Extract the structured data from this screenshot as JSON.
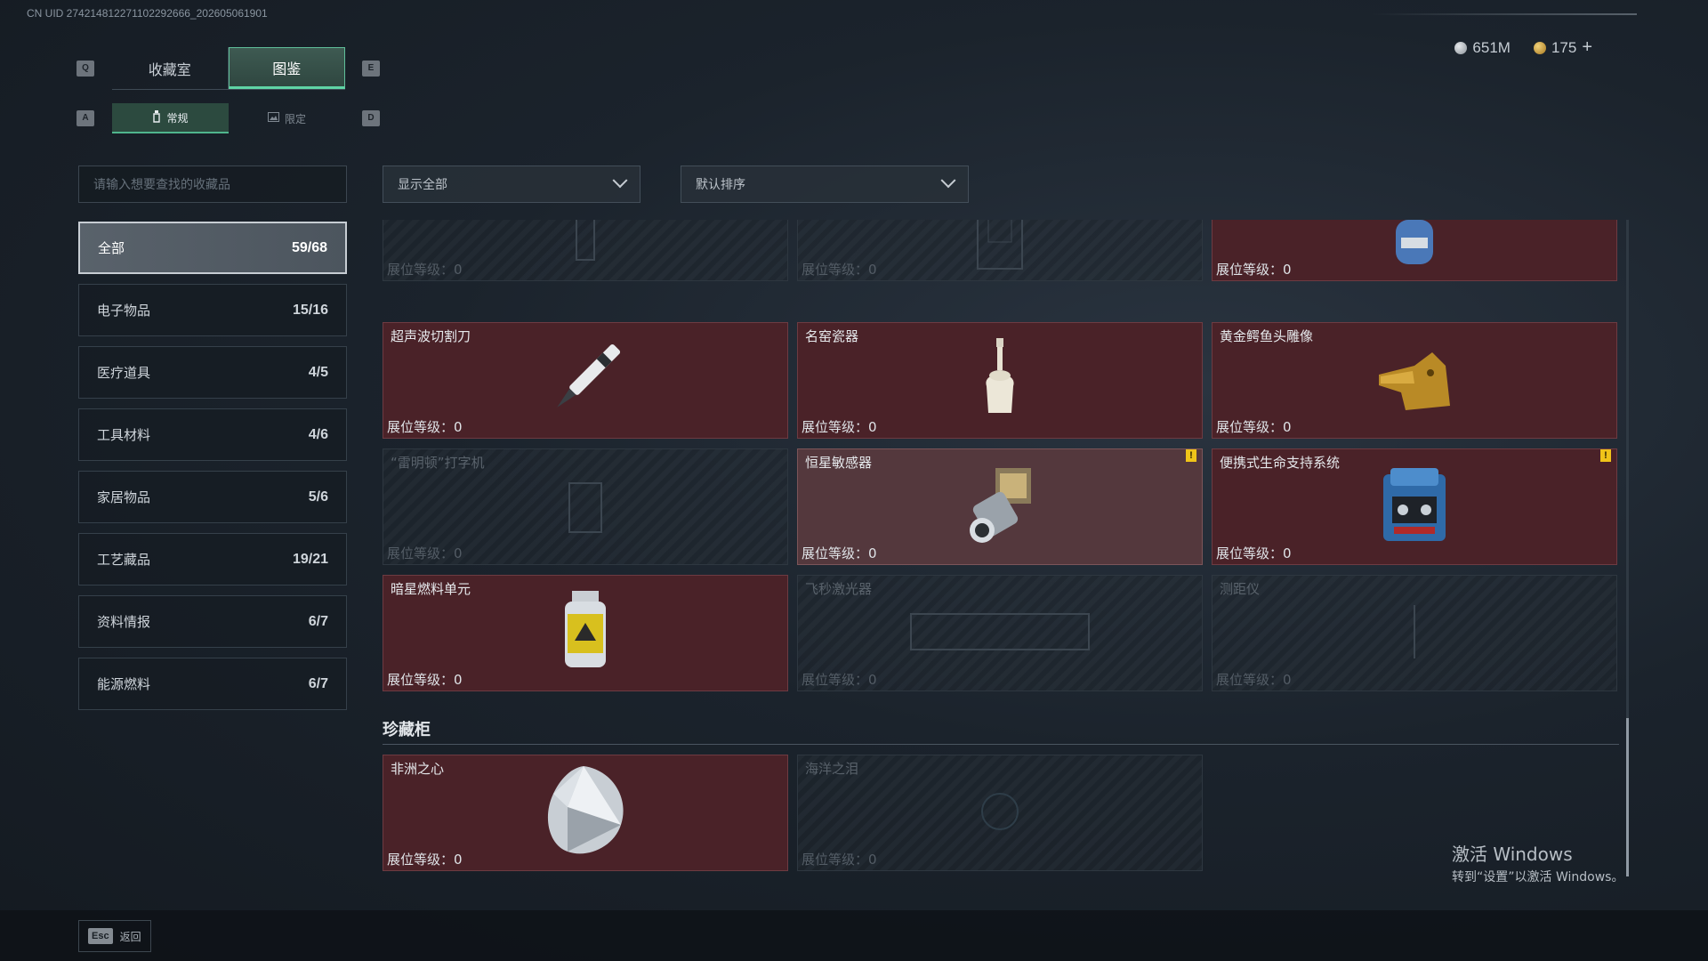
{
  "uid_text": "CN UID 274214812271102292666_202605061901",
  "hotkeys": {
    "prev_tab": "Q",
    "next_tab": "E",
    "prev_sub": "A",
    "next_sub": "D"
  },
  "tabs": [
    {
      "label": "收藏室",
      "active": false
    },
    {
      "label": "图鉴",
      "active": true
    }
  ],
  "subtabs": [
    {
      "label": "常规",
      "active": true,
      "icon": "bottle-icon"
    },
    {
      "label": "限定",
      "active": false,
      "icon": "image-icon"
    }
  ],
  "currency": {
    "silver": "651M",
    "gold": "175",
    "add": "+"
  },
  "search": {
    "placeholder": "请输入想要查找的收藏品"
  },
  "categories": [
    {
      "label": "全部",
      "count": "59/68",
      "active": true
    },
    {
      "label": "电子物品",
      "count": "15/16"
    },
    {
      "label": "医疗道具",
      "count": "4/5"
    },
    {
      "label": "工具材料",
      "count": "4/6"
    },
    {
      "label": "家居物品",
      "count": "5/6"
    },
    {
      "label": "工艺藏品",
      "count": "19/21"
    },
    {
      "label": "资料情报",
      "count": "6/7"
    },
    {
      "label": "能源燃料",
      "count": "6/7"
    }
  ],
  "filters": {
    "show": "显示全部",
    "sort": "默认排序"
  },
  "items": [
    {
      "name": "",
      "level": "展位等级：0",
      "owned": false,
      "icon": "figurine-icon"
    },
    {
      "name": "",
      "level": "展位等级：0",
      "owned": false,
      "icon": "cabinet-icon"
    },
    {
      "name": "",
      "level": "展位等级：0",
      "owned": true,
      "icon": "gas-canister-icon"
    },
    {
      "name": "超声波切割刀",
      "level": "展位等级：0",
      "owned": true,
      "icon": "ultrasonic-cutter-icon"
    },
    {
      "name": "名窑瓷器",
      "level": "展位等级：0",
      "owned": true,
      "icon": "porcelain-vase-icon"
    },
    {
      "name": "黄金鳄鱼头雕像",
      "level": "展位等级：0",
      "owned": true,
      "icon": "gold-crocodile-icon"
    },
    {
      "name": "“雷明顿”打字机",
      "level": "展位等级：0",
      "owned": false,
      "icon": "typewriter-icon"
    },
    {
      "name": "恒星敏感器",
      "level": "展位等级：0",
      "owned": true,
      "highlight": true,
      "warn": true,
      "icon": "star-sensor-icon"
    },
    {
      "name": "便携式生命支持系统",
      "level": "展位等级：0",
      "owned": true,
      "warn": true,
      "icon": "life-support-icon"
    },
    {
      "name": "暗星燃料单元",
      "level": "展位等级：0",
      "owned": true,
      "icon": "fuel-cell-icon"
    },
    {
      "name": "飞秒激光器",
      "level": "展位等级：0",
      "owned": false,
      "icon": "laser-icon"
    },
    {
      "name": "测距仪",
      "level": "展位等级：0",
      "owned": false,
      "icon": "rangefinder-icon"
    }
  ],
  "treasure_section": {
    "title": "珍藏柜",
    "items": [
      {
        "name": "非洲之心",
        "level": "展位等级：0",
        "owned": true,
        "icon": "diamond-icon"
      },
      {
        "name": "海洋之泪",
        "level": "展位等级：0",
        "owned": false,
        "icon": "sapphire-icon"
      }
    ]
  },
  "warn_mark": "!",
  "watermark": {
    "line1": "激活 Windows",
    "line2": "转到“设置”以激活 Windows。"
  },
  "footer": {
    "esc_key": "Esc",
    "back_label": "返回"
  }
}
